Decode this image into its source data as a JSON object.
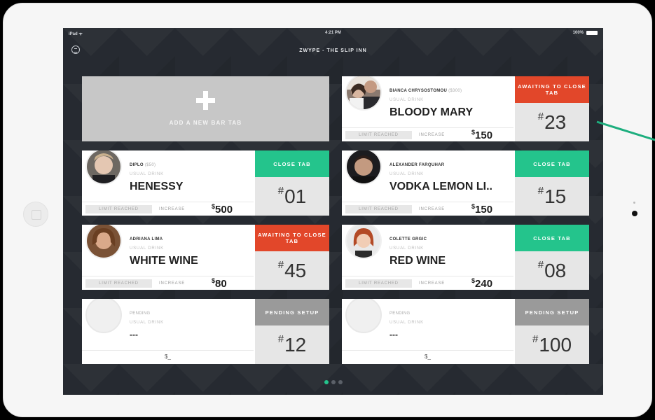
{
  "statusbar": {
    "left": "iPad ᯤ",
    "time": "4:21 PM",
    "battery": "100%"
  },
  "header": {
    "title": "ZWYPE - THE SLIP INN"
  },
  "add_tab": {
    "label": "ADD A NEW BAR TAB"
  },
  "labels": {
    "usual_drink": "USUAL DRINK",
    "limit_reached": "LIMIT REACHED",
    "increase": "INCREASE",
    "currency": "$"
  },
  "tabs": [
    {
      "name": "BIANCA CHRYSOSTOMOU",
      "limit": "($300)",
      "drink": "BLOODY MARY",
      "amount": "150",
      "status": "AWAITING TO CLOSE TAB",
      "status_color": "#e2472a",
      "number": "23"
    },
    {
      "name": "DIPLO",
      "limit": "($50)",
      "drink": "HENESSY",
      "amount": "500",
      "status": "CLOSE TAB",
      "status_color": "#24c48c",
      "number": "01"
    },
    {
      "name": "ALEXANDER FARQUHAR",
      "limit": "",
      "drink": "VODKA LEMON LI..",
      "amount": "150",
      "status": "CLOSE TAB",
      "status_color": "#24c48c",
      "number": "15"
    },
    {
      "name": "ADRIANA LIMA",
      "limit": "",
      "drink": "WHITE WINE",
      "amount": "80",
      "status": "AWAITING TO CLOSE TAB",
      "status_color": "#e2472a",
      "number": "45"
    },
    {
      "name": "COLETTE GRGIC",
      "limit": "",
      "drink": "RED WINE",
      "amount": "240",
      "status": "CLOSE TAB",
      "status_color": "#24c48c",
      "number": "08"
    },
    {
      "name": "PENDING",
      "drink": "---",
      "amount_placeholder": "$_",
      "status": "PENDING SETUP",
      "status_color": "#9a9a9a",
      "number": "12"
    },
    {
      "name": "PENDING",
      "drink": "---",
      "amount_placeholder": "$_",
      "status": "PENDING SETUP",
      "status_color": "#9a9a9a",
      "number": "100"
    }
  ],
  "pager": {
    "current": 1,
    "total": 3
  },
  "annotation": {
    "arrow_color": "#1dae7e"
  }
}
